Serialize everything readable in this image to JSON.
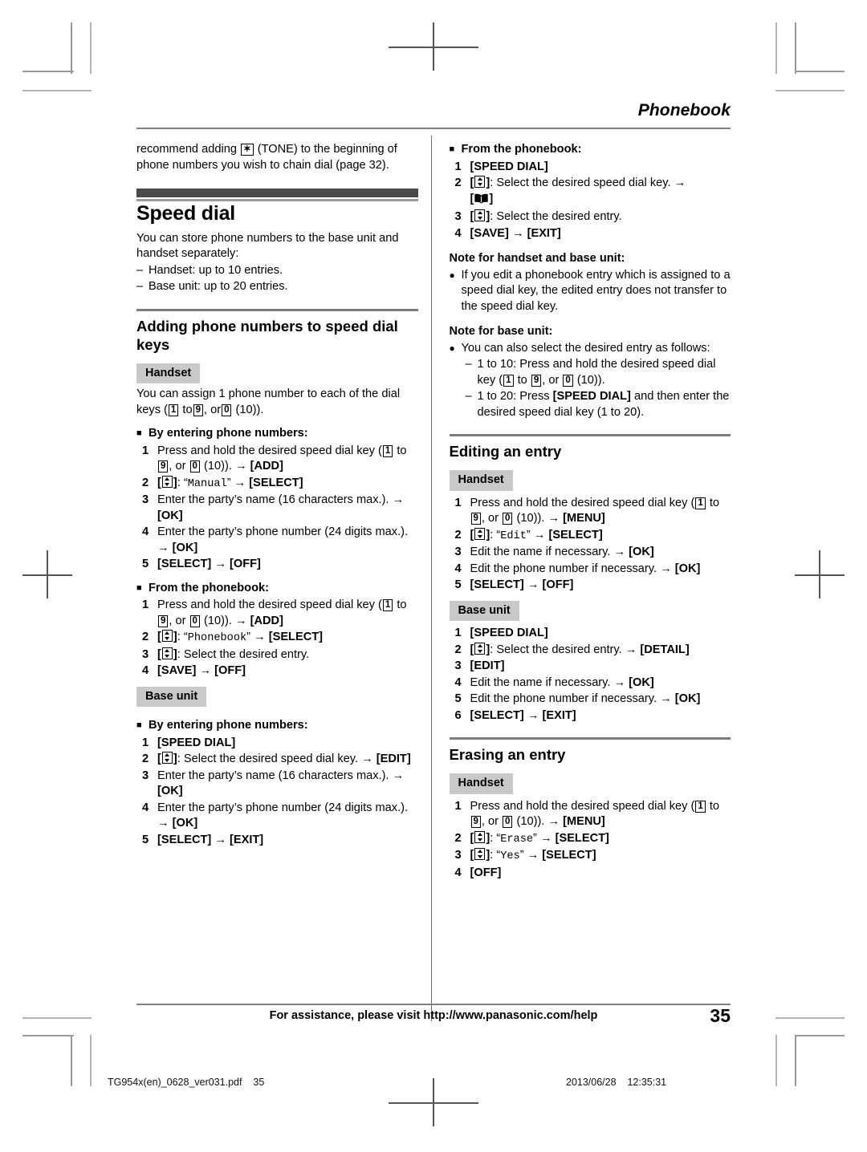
{
  "header": {
    "title": "Phonebook"
  },
  "left_column": {
    "intro": {
      "before_key": "recommend adding",
      "key": "*",
      "after_key": "(TONE) to the beginning of phone numbers you wish to chain dial (page 32)."
    },
    "speed_dial": {
      "heading": "Speed dial",
      "body": "You can store phone numbers to the base unit and handset separately:",
      "capacity": [
        "Handset: up to 10 entries.",
        "Base unit: up to 20 entries."
      ]
    },
    "adding": {
      "heading": "Adding phone numbers to speed dial keys",
      "handset_tag": "Handset",
      "handset_body_1": "You can assign 1 phone number to each of the dial keys (",
      "handset_body_2": "to",
      "handset_body_3": ", or",
      "handset_body_4": "(10)).",
      "keys": {
        "one": "1",
        "nine": "9",
        "zero": "0"
      },
      "by_entering": {
        "label": "By entering phone numbers:",
        "steps": [
          {
            "num": "1",
            "parts": [
              "Press and hold the desired speed dial key (",
              "1",
              " to ",
              "9",
              ", or ",
              "0",
              " (10)). ",
              "→",
              " [ADD]"
            ]
          },
          {
            "num": "2",
            "display": "Manual",
            "softkey": "[SELECT]"
          },
          {
            "num": "3",
            "text": "Enter the party’s name (16 characters max.). → [OK]"
          },
          {
            "num": "4",
            "text": "Enter the party’s phone number (24 digits max.). → [OK]"
          },
          {
            "num": "5",
            "text": "[SELECT] → [OFF]"
          }
        ]
      },
      "from_phonebook": {
        "label": "From the phonebook:",
        "steps": [
          {
            "num": "1",
            "text": "Press and hold the desired speed dial key (1 to 9, or 0 (10)). → [ADD]"
          },
          {
            "num": "2",
            "display": "Phonebook",
            "softkey": "[SELECT]"
          },
          {
            "num": "3",
            "text": "[↕]: Select the desired entry."
          },
          {
            "num": "4",
            "text": "[SAVE] → [OFF]"
          }
        ]
      },
      "base_tag": "Base unit",
      "base_by_entering": {
        "label": "By entering phone numbers:",
        "steps": [
          {
            "num": "1",
            "text": "[SPEED DIAL]"
          },
          {
            "num": "2",
            "text": "[↕]: Select the desired speed dial key. → [EDIT]"
          },
          {
            "num": "3",
            "text": "Enter the party’s name (16 characters max.). → [OK]"
          },
          {
            "num": "4",
            "text": "Enter the party’s phone number (24 digits max.). → [OK]"
          },
          {
            "num": "5",
            "text": "[SELECT] → [EXIT]"
          }
        ]
      }
    }
  },
  "right_column": {
    "from_phonebook": {
      "label": "From the phonebook:",
      "steps": [
        {
          "num": "1",
          "text": "[SPEED DIAL]"
        },
        {
          "num": "2",
          "text": "[↕]: Select the desired speed dial key. → [📖]"
        },
        {
          "num": "3",
          "text": "[↕]: Select the desired entry."
        },
        {
          "num": "4",
          "text": "[SAVE] → [EXIT]"
        }
      ]
    },
    "note_handset_base": {
      "heading": "Note for handset and base unit:",
      "bullets": [
        "If you edit a phonebook entry which is assigned to a speed dial key, the edited entry does not transfer to the speed dial key."
      ]
    },
    "note_base": {
      "heading": "Note for base unit:",
      "bullet": "You can also select the desired entry as follows:",
      "sub": [
        "1 to 10: Press and hold the desired speed dial key (1 to 9, or 0 (10)).",
        "1 to 20: Press [SPEED DIAL] and then enter the desired speed dial key (1 to 20)."
      ]
    },
    "editing": {
      "heading": "Editing an entry",
      "handset_tag": "Handset",
      "handset_steps": [
        {
          "num": "1",
          "text": "Press and hold the desired speed dial key (1 to 9, or 0 (10)). → [MENU]"
        },
        {
          "num": "2",
          "display": "Edit",
          "softkey": "[SELECT]"
        },
        {
          "num": "3",
          "text": "Edit the name if necessary. → [OK]"
        },
        {
          "num": "4",
          "text": "Edit the phone number if necessary. → [OK]"
        },
        {
          "num": "5",
          "text": "[SELECT] → [OFF]"
        }
      ],
      "base_tag": "Base unit",
      "base_steps": [
        {
          "num": "1",
          "text": "[SPEED DIAL]"
        },
        {
          "num": "2",
          "text": "[↕]: Select the desired entry. → [DETAIL]"
        },
        {
          "num": "3",
          "text": "[EDIT]"
        },
        {
          "num": "4",
          "text": "Edit the name if necessary. → [OK]"
        },
        {
          "num": "5",
          "text": "Edit the phone number if necessary. → [OK]"
        },
        {
          "num": "6",
          "text": "[SELECT] → [EXIT]"
        }
      ]
    },
    "erasing": {
      "heading": "Erasing an entry",
      "handset_tag": "Handset",
      "steps": [
        {
          "num": "1",
          "text": "Press and hold the desired speed dial key (1 to 9, or 0 (10)). → [MENU]"
        },
        {
          "num": "2",
          "display": "Erase",
          "softkey": "[SELECT]"
        },
        {
          "num": "3",
          "display": "Yes",
          "softkey": "[SELECT]"
        },
        {
          "num": "4",
          "text": "[OFF]"
        }
      ]
    }
  },
  "footer": {
    "assistance": "For assistance, please visit http://www.panasonic.com/help",
    "page_number": "35"
  },
  "print_info": {
    "file": "TG954x(en)_0628_ver031.pdf    35",
    "stamp": "2013/06/28    12:35:31"
  },
  "labels": {
    "arrow": "→",
    "dash": "–",
    "square_bullet": "■",
    "round_bullet": "●",
    "tone_key": "✶"
  }
}
